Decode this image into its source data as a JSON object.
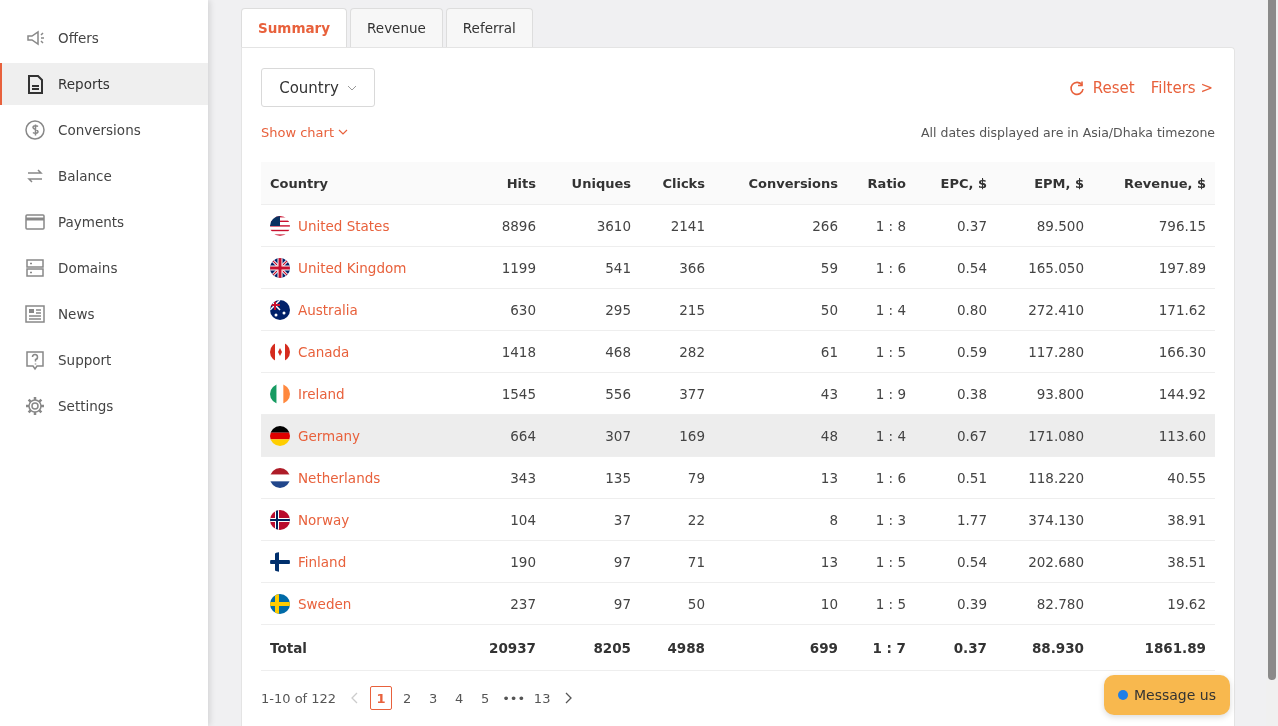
{
  "sidebar": {
    "items": [
      {
        "label": "Offers",
        "selected": false
      },
      {
        "label": "Reports",
        "selected": true
      },
      {
        "label": "Conversions",
        "selected": false
      },
      {
        "label": "Balance",
        "selected": false
      },
      {
        "label": "Payments",
        "selected": false
      },
      {
        "label": "Domains",
        "selected": false
      },
      {
        "label": "News",
        "selected": false
      },
      {
        "label": "Support",
        "selected": false
      },
      {
        "label": "Settings",
        "selected": false
      }
    ]
  },
  "tabs": [
    {
      "label": "Summary",
      "selected": true
    },
    {
      "label": "Revenue",
      "selected": false
    },
    {
      "label": "Referral",
      "selected": false
    }
  ],
  "group_by": {
    "value": "Country"
  },
  "reset_label": "Reset",
  "filters_label": "Filters >",
  "show_chart_label": "Show chart",
  "timezone_note": "All dates displayed are in Asia/Dhaka timezone",
  "table": {
    "columns": [
      "Country",
      "Hits",
      "Uniques",
      "Clicks",
      "Conversions",
      "Ratio",
      "EPC, $",
      "EPM, $",
      "Revenue, $"
    ],
    "rows": [
      {
        "cells": [
          "United States",
          "8896",
          "3610",
          "2141",
          "266",
          "1 : 8",
          "0.37",
          "89.500",
          "796.15"
        ],
        "highlighted": false
      },
      {
        "cells": [
          "United Kingdom",
          "1199",
          "541",
          "366",
          "59",
          "1 : 6",
          "0.54",
          "165.050",
          "197.89"
        ],
        "highlighted": false
      },
      {
        "cells": [
          "Australia",
          "630",
          "295",
          "215",
          "50",
          "1 : 4",
          "0.80",
          "272.410",
          "171.62"
        ],
        "highlighted": false
      },
      {
        "cells": [
          "Canada",
          "1418",
          "468",
          "282",
          "61",
          "1 : 5",
          "0.59",
          "117.280",
          "166.30"
        ],
        "highlighted": false
      },
      {
        "cells": [
          "Ireland",
          "1545",
          "556",
          "377",
          "43",
          "1 : 9",
          "0.38",
          "93.800",
          "144.92"
        ],
        "highlighted": false
      },
      {
        "cells": [
          "Germany",
          "664",
          "307",
          "169",
          "48",
          "1 : 4",
          "0.67",
          "171.080",
          "113.60"
        ],
        "highlighted": true
      },
      {
        "cells": [
          "Netherlands",
          "343",
          "135",
          "79",
          "13",
          "1 : 6",
          "0.51",
          "118.220",
          "40.55"
        ],
        "highlighted": false
      },
      {
        "cells": [
          "Norway",
          "104",
          "37",
          "22",
          "8",
          "1 : 3",
          "1.77",
          "374.130",
          "38.91"
        ],
        "highlighted": false
      },
      {
        "cells": [
          "Finland",
          "190",
          "97",
          "71",
          "13",
          "1 : 5",
          "0.54",
          "202.680",
          "38.51"
        ],
        "highlighted": false
      },
      {
        "cells": [
          "Sweden",
          "237",
          "97",
          "50",
          "10",
          "1 : 5",
          "0.39",
          "82.780",
          "19.62"
        ],
        "highlighted": false
      }
    ],
    "total": [
      "Total",
      "20937",
      "8205",
      "4988",
      "699",
      "1 : 7",
      "0.37",
      "88.930",
      "1861.89"
    ]
  },
  "pagination": {
    "range": "1-10 of 122",
    "pages": [
      {
        "label": "1",
        "selected": true
      },
      {
        "label": "2",
        "selected": false
      },
      {
        "label": "3",
        "selected": false
      },
      {
        "label": "4",
        "selected": false
      },
      {
        "label": "5",
        "selected": false
      },
      {
        "label": "•••",
        "selected": false
      },
      {
        "label": "13",
        "selected": false
      }
    ]
  },
  "chat_button": {
    "label": "Message us"
  }
}
